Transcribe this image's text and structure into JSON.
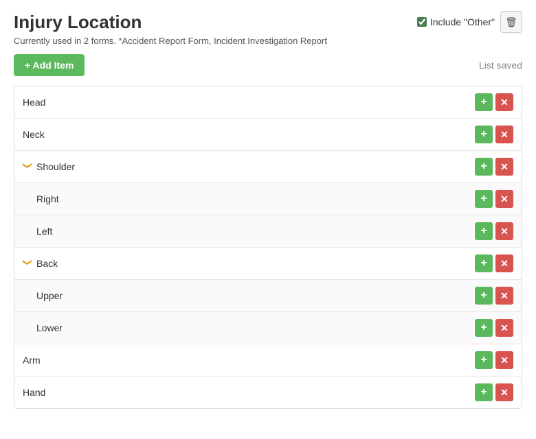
{
  "page": {
    "title": "Injury Location",
    "subtitle": "Currently used in 2 forms. *Accident Report Form, Incident Investigation Report",
    "include_other_label": "Include \"Other\"",
    "include_other_checked": true,
    "add_item_label": "+ Add Item",
    "list_saved_label": "List saved"
  },
  "items": [
    {
      "id": "head",
      "name": "Head",
      "level": 0,
      "expanded": false
    },
    {
      "id": "neck",
      "name": "Neck",
      "level": 0,
      "expanded": false
    },
    {
      "id": "shoulder",
      "name": "Shoulder",
      "level": 0,
      "expanded": true
    },
    {
      "id": "shoulder-right",
      "name": "Right",
      "level": 1,
      "expanded": false
    },
    {
      "id": "shoulder-left",
      "name": "Left",
      "level": 1,
      "expanded": false
    },
    {
      "id": "back",
      "name": "Back",
      "level": 0,
      "expanded": true
    },
    {
      "id": "back-upper",
      "name": "Upper",
      "level": 1,
      "expanded": false
    },
    {
      "id": "back-lower",
      "name": "Lower",
      "level": 1,
      "expanded": false
    },
    {
      "id": "arm",
      "name": "Arm",
      "level": 0,
      "expanded": false
    },
    {
      "id": "hand",
      "name": "Hand",
      "level": 0,
      "expanded": false
    }
  ],
  "icons": {
    "plus": "+",
    "times": "✕",
    "chevron_down": "❯",
    "trash": "🗑"
  }
}
